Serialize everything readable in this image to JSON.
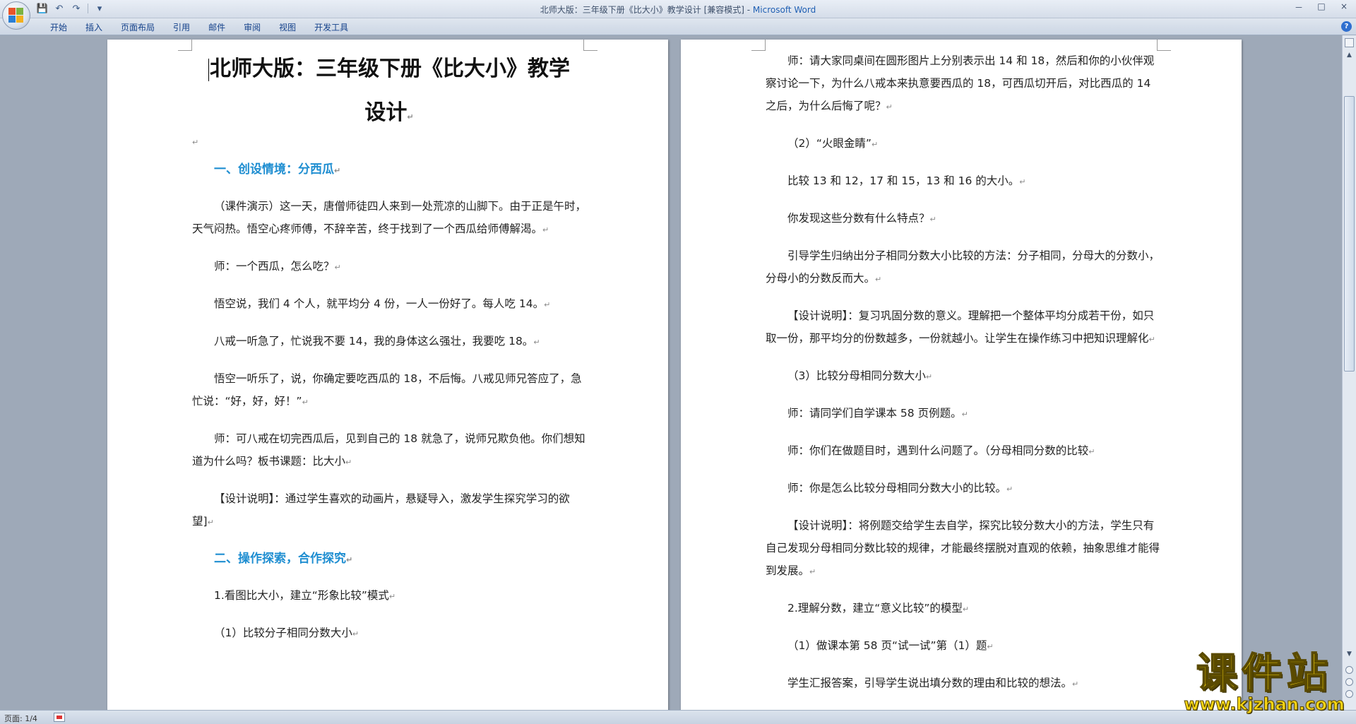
{
  "window": {
    "title": "北师大版：三年级下册《比大小》教学设计 [兼容模式] - ",
    "app_name": "Microsoft Word",
    "controls": [
      "－",
      "□",
      "×"
    ]
  },
  "qat": {
    "save_icon": "💾",
    "undo_icon": "↶",
    "redo_icon": "↷",
    "customize_icon": "▾"
  },
  "ribbon": {
    "tabs": [
      "开始",
      "插入",
      "页面布局",
      "引用",
      "邮件",
      "审阅",
      "视图",
      "开发工具"
    ],
    "help_label": "?"
  },
  "document": {
    "pmark": "↵",
    "title_line1": "北师大版：三年级下册《比大小》教学",
    "title_line2": "设计",
    "page1": [
      {
        "type": "heading",
        "text": "一、创设情境：分西瓜"
      },
      {
        "type": "para",
        "text": "（课件演示）这一天，唐僧师徒四人来到一处荒凉的山脚下。由于正是午时，天气闷热。悟空心疼师傅，不辞辛苦，终于找到了一个西瓜给师傅解渴。"
      },
      {
        "type": "para",
        "text": "师：一个西瓜，怎么吃？"
      },
      {
        "type": "para",
        "text": "悟空说，我们 4 个人，就平均分 4 份，一人一份好了。每人吃 14。"
      },
      {
        "type": "para",
        "text": "八戒一听急了，忙说我不要 14，我的身体这么强壮，我要吃 18。"
      },
      {
        "type": "para",
        "text": "悟空一听乐了，说，你确定要吃西瓜的 18，不后悔。八戒见师兄答应了，急忙说：“好，好，好！”"
      },
      {
        "type": "para",
        "text": "师：可八戒在切完西瓜后，见到自己的 18 就急了，说师兄欺负他。你们想知道为什么吗？板书课题：比大小"
      },
      {
        "type": "para",
        "text": "【设计说明】：通过学生喜欢的动画片，悬疑导入，激发学生探究学习的欲望]"
      },
      {
        "type": "heading",
        "text": "二、操作探索，合作探究"
      },
      {
        "type": "para",
        "text": "1.看图比大小，建立“形象比较”模式"
      },
      {
        "type": "para",
        "text": "（1）比较分子相同分数大小"
      }
    ],
    "page2": [
      {
        "type": "para",
        "text": "师：请大家同桌间在圆形图片上分别表示出 14 和 18，然后和你的小伙伴观察讨论一下，为什么八戒本来执意要西瓜的 18，可西瓜切开后，对比西瓜的 14 之后，为什么后悔了呢？"
      },
      {
        "type": "para",
        "text": "（2）“火眼金睛”"
      },
      {
        "type": "para",
        "text": "比较 13 和 12，17 和 15，13 和 16 的大小。"
      },
      {
        "type": "para",
        "text": "你发现这些分数有什么特点？"
      },
      {
        "type": "para",
        "text": "引导学生归纳出分子相同分数大小比较的方法：分子相同，分母大的分数小，分母小的分数反而大。"
      },
      {
        "type": "para",
        "text": "【设计说明】：复习巩固分数的意义。理解把一个整体平均分成若干份，如只取一份，那平均分的份数越多，一份就越小。让学生在操作练习中把知识理解化"
      },
      {
        "type": "para",
        "text": "（3）比较分母相同分数大小"
      },
      {
        "type": "para",
        "text": "师：请同学们自学课本 58 页例题。"
      },
      {
        "type": "para",
        "text": "师：你们在做题目时，遇到什么问题了。（分母相同分数的比较"
      },
      {
        "type": "para",
        "text": "师：你是怎么比较分母相同分数大小的比较。"
      },
      {
        "type": "para",
        "text": "【设计说明】：将例题交给学生去自学，探究比较分数大小的方法，学生只有自己发现分母相同分数比较的规律，才能最终摆脱对直观的依赖，抽象思维才能得到发展。"
      },
      {
        "type": "para",
        "text": "2.理解分数，建立“意义比较”的模型"
      },
      {
        "type": "para",
        "text": "（1）做课本第 58 页“试一试”第（1）题"
      },
      {
        "type": "para",
        "text": "学生汇报答案，引导学生说出填分数的理由和比较的想法。"
      }
    ]
  },
  "statusbar": {
    "page_label": "页面: 1/4"
  },
  "watermark": {
    "main": "课件站",
    "url": "www.kjzhan.com"
  },
  "colors": {
    "heading": "#1f8ed1",
    "app_name": "#1f5fb3",
    "watermark": "#f7d514"
  }
}
